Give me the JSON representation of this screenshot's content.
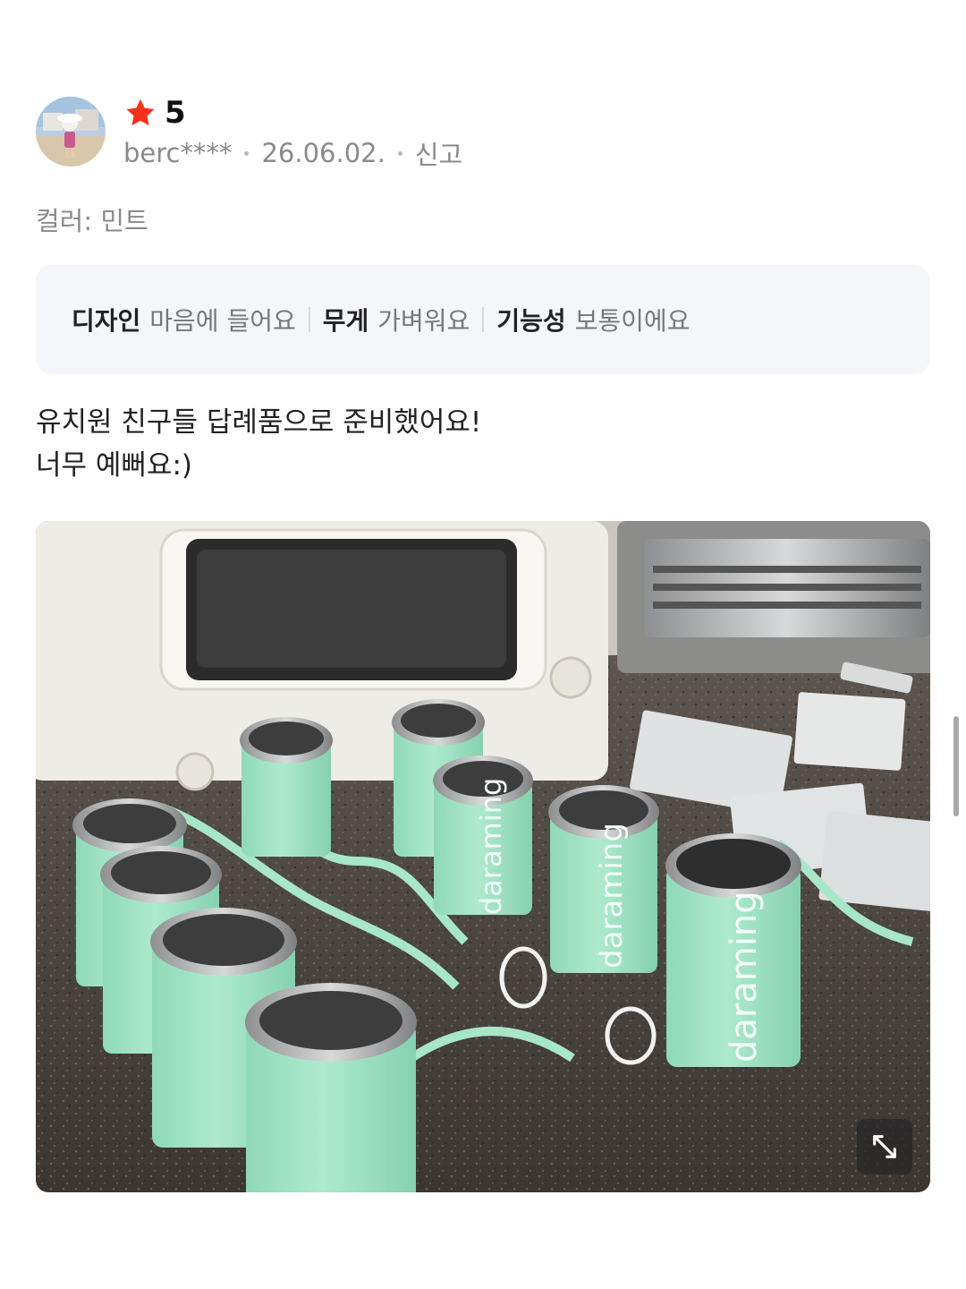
{
  "review": {
    "rating": "5",
    "author": "berc****",
    "date": "26.06.02.",
    "report_label": "신고",
    "option": "컬러: 민트",
    "survey": [
      {
        "key": "디자인",
        "value": "마음에 들어요"
      },
      {
        "key": "무게",
        "value": "가벼워요"
      },
      {
        "key": "기능성",
        "value": "보통이에요"
      }
    ],
    "body_lines": [
      "유치원 친구들 답례품으로 준비했어요!",
      "너무 예뻐요:)"
    ],
    "photo_brand_text": "daraming"
  },
  "colors": {
    "star": "#f5311b",
    "mint": "#9fe3c4",
    "survey_bg": "#f5f6f9"
  },
  "icons": {
    "rating": "star-icon",
    "expand": "expand-icon"
  }
}
